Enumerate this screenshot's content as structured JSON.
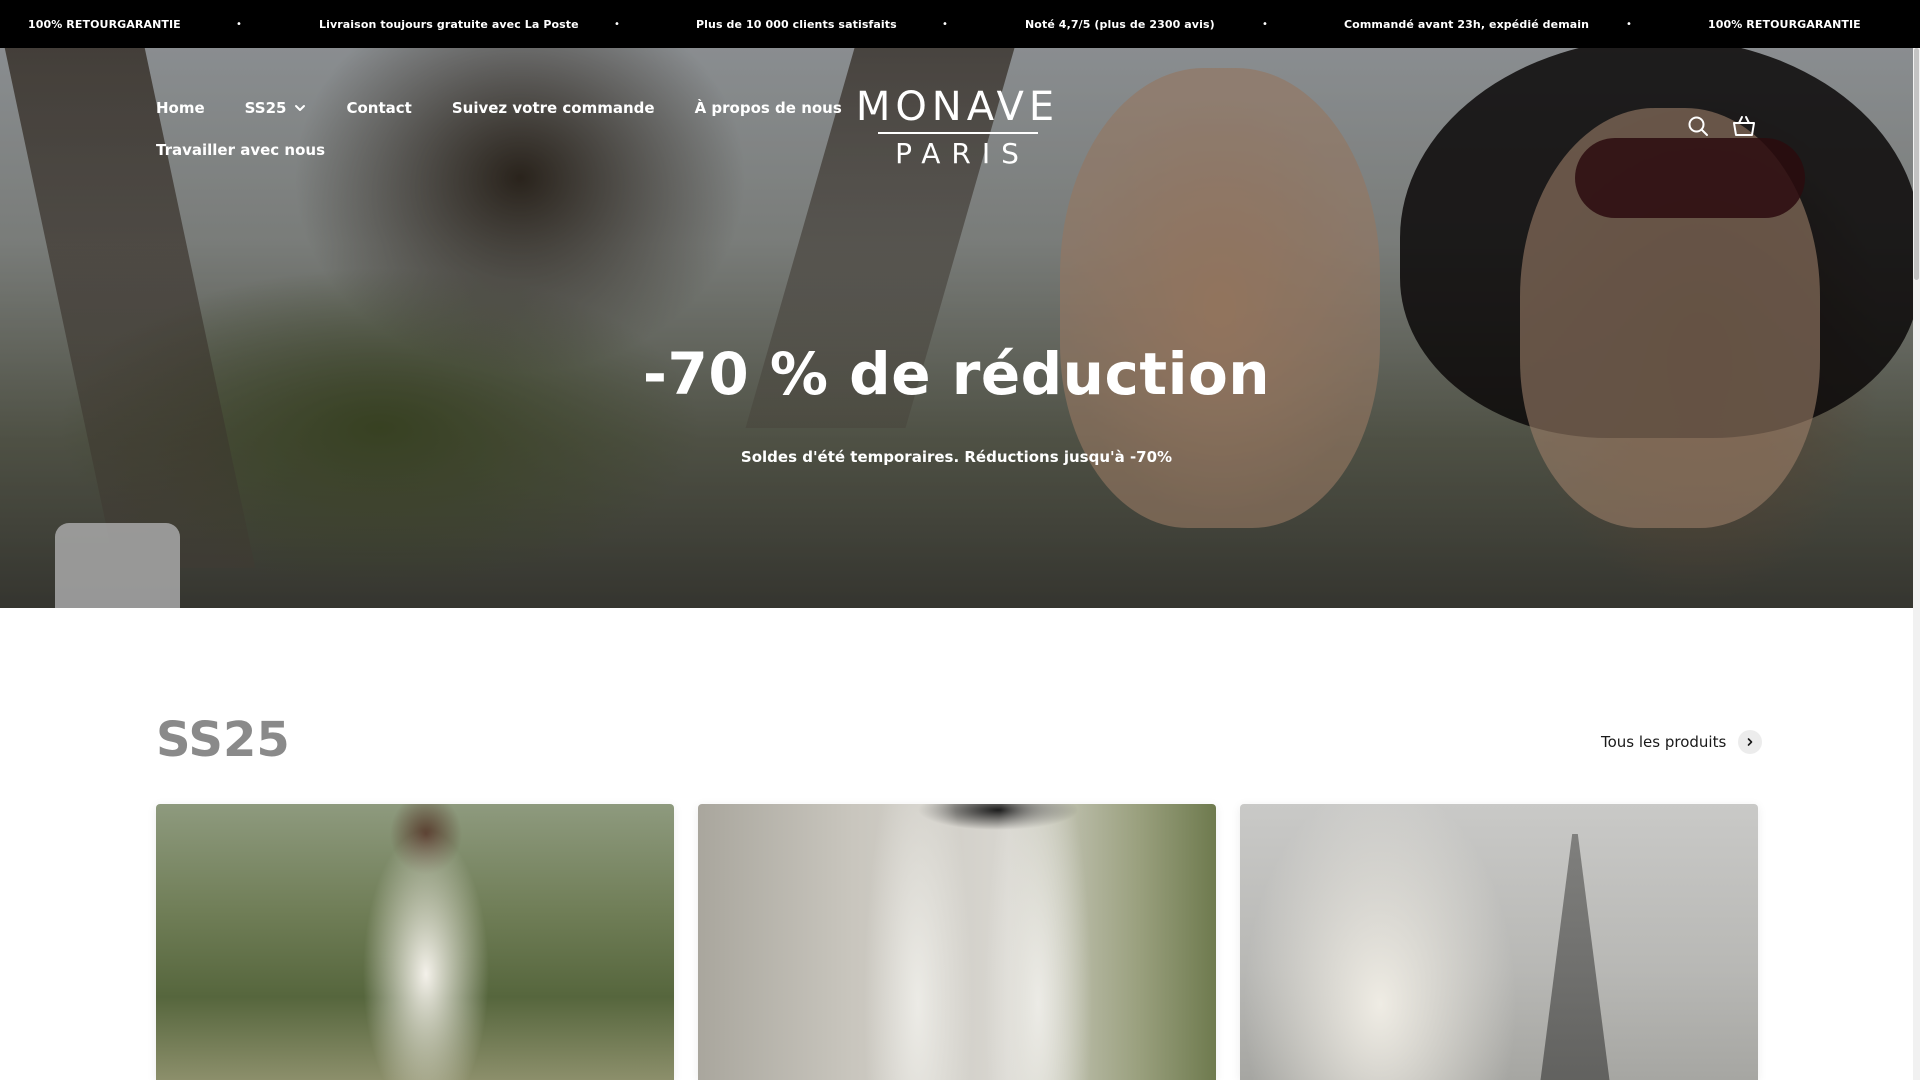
{
  "announcement": {
    "items": [
      "100% RETOURGARANTIE",
      "Livraison toujours gratuite avec La Poste",
      "Plus de 10 000 clients satisfaits",
      "Noté 4,7/5 (plus de 2300 avis)",
      "Commandé avant 23h, expédié demain",
      "100% RETOURGARANTIE"
    ],
    "separator": "•"
  },
  "nav": {
    "home": "Home",
    "ss25": "SS25",
    "contact": "Contact",
    "track_order": "Suivez votre commande",
    "about": "À propos de nous",
    "careers": "Travailler avec nous"
  },
  "logo": {
    "top": "MONAVE",
    "bottom": "PARIS"
  },
  "icons": {
    "search": "search-icon",
    "cart": "basket-icon"
  },
  "hero": {
    "title": "-70 % de réduction",
    "subtitle": "Soldes d'été temporaires. Réductions jusqu'à -70%"
  },
  "collection": {
    "title": "SS25",
    "all_products": "Tous les produits"
  },
  "colors": {
    "announcement_bg": "#000000",
    "text_light": "#ffffff",
    "section_title": "#8a8a8a"
  }
}
